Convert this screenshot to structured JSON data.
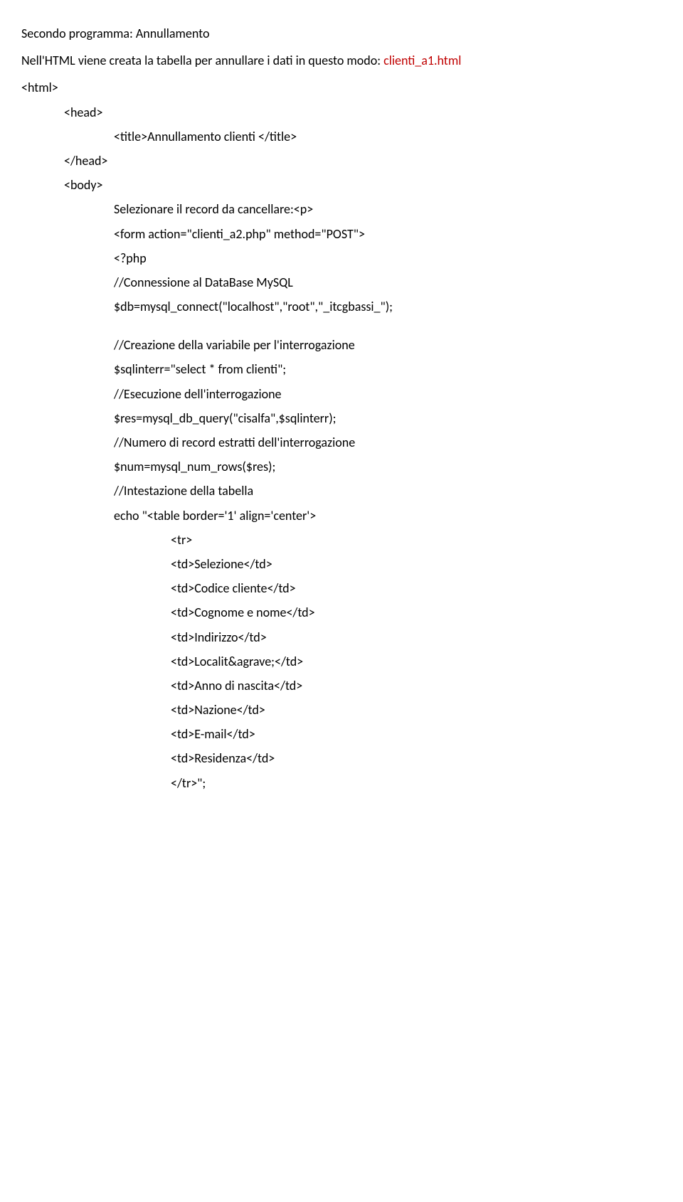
{
  "heading": "Secondo programma: Annullamento",
  "intro_before": "Nell'HTML  viene creata la tabella per annullare i dati in questo modo: ",
  "intro_red": "clienti_a1.html",
  "lines": [
    {
      "text": "<html>",
      "indent": 0
    },
    {
      "text": "<head>",
      "indent": 1
    },
    {
      "text": "<title>Annullamento clienti </title>",
      "indent": 2
    },
    {
      "text": "</head>",
      "indent": 1
    },
    {
      "text": "<body>",
      "indent": 1
    },
    {
      "text": "Selezionare il record da cancellare:<p>",
      "indent": 2
    },
    {
      "text": "<form action=\"clienti_a2.php\" method=\"POST\">",
      "indent": 2
    },
    {
      "text": "<?php",
      "indent": 2
    },
    {
      "text": "//Connessione al DataBase MySQL",
      "indent": 2
    },
    {
      "text": "$db=mysql_connect(\"localhost\",\"root\",\"_itcgbassi_\");",
      "indent": 2
    },
    {
      "text": "",
      "indent": 2,
      "blank": true
    },
    {
      "text": "//Creazione della variabile per l'interrogazione",
      "indent": 2
    },
    {
      "text": "$sqlinterr=\"select * from clienti\";",
      "indent": 2
    },
    {
      "text": "//Esecuzione dell'interrogazione",
      "indent": 2
    },
    {
      "text": "$res=mysql_db_query(\"cisalfa\",$sqlinterr);",
      "indent": 2
    },
    {
      "text": "//Numero di record estratti dell'interrogazione",
      "indent": 2
    },
    {
      "text": "$num=mysql_num_rows($res);",
      "indent": 2
    },
    {
      "text": "//Intestazione della tabella",
      "indent": 2
    },
    {
      "text": "echo \"<table border='1' align='center'>",
      "indent": 2
    },
    {
      "text": "<tr>",
      "indent": 3
    },
    {
      "text": "<td>Selezione</td>",
      "indent": 3
    },
    {
      "text": "<td>Codice cliente</td>",
      "indent": 3
    },
    {
      "text": "<td>Cognome e nome</td>",
      "indent": 3
    },
    {
      "text": "<td>Indirizzo</td>",
      "indent": 3
    },
    {
      "text": "<td>Localit&agrave;</td>",
      "indent": 3
    },
    {
      "text": "<td>Anno di nascita</td>",
      "indent": 3
    },
    {
      "text": "<td>Nazione</td>",
      "indent": 3
    },
    {
      "text": "<td>E-mail</td>",
      "indent": 3
    },
    {
      "text": "<td>Residenza</td>",
      "indent": 3
    },
    {
      "text": "</tr>\";",
      "indent": 3
    }
  ]
}
